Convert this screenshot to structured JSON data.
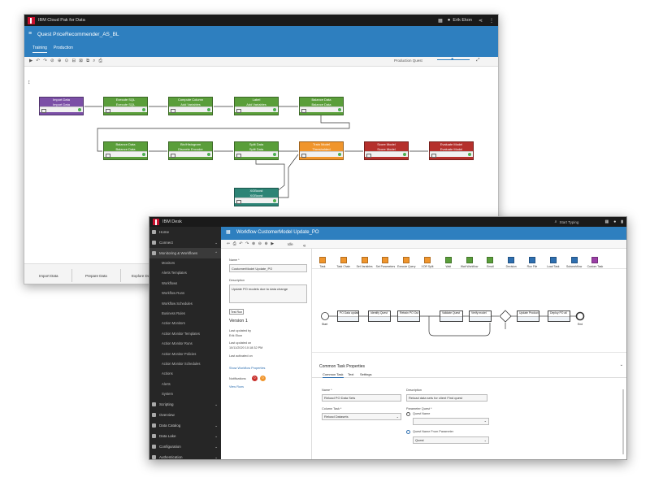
{
  "win1": {
    "app_title": "IBM Cloud Pak for Data",
    "user": "Erik Ekon",
    "project_title": "Quest PriceRecommender_AS_BL",
    "tabs": [
      "Training",
      "Production"
    ],
    "prod_label": "Production Quest",
    "nodes": [
      {
        "title": "Import Data",
        "sub": "Import Data",
        "color": "purple"
      },
      {
        "title": "Execute SQL",
        "sub": "Execute SQL",
        "color": "green"
      },
      {
        "title": "Compute Column",
        "sub": "Add Variables",
        "color": "green"
      },
      {
        "title": "Label",
        "sub": "Add Variables",
        "color": "green"
      },
      {
        "title": "Balance Data",
        "sub": "Balance Data",
        "color": "green"
      },
      {
        "title": "Balance Data",
        "sub": "Balance Data",
        "color": "green"
      },
      {
        "title": "Bin/Histogram",
        "sub": "Discrete Encoder",
        "color": "green"
      },
      {
        "title": "Split Data",
        "sub": "Split Data",
        "color": "green"
      },
      {
        "title": "Train Model",
        "sub": "Thresholded",
        "color": "orange"
      },
      {
        "title": "Score Model",
        "sub": "Score Model",
        "color": "red"
      },
      {
        "title": "Evaluate Model",
        "sub": "Evaluate Model",
        "color": "red"
      },
      {
        "title": "XGBoost",
        "sub": "XGBoost",
        "color": "teal"
      }
    ],
    "bottom_tabs": [
      "Import Data",
      "Prepare Data",
      "Explore Data"
    ]
  },
  "win2": {
    "app_title": "IBM Desk",
    "search_placeholder": "Start Typing",
    "header_title": "Workflow CustomerModel Update_PO",
    "toolbar_label": "Idle",
    "sidebar": {
      "top": [
        {
          "label": "Home"
        },
        {
          "label": "Connect"
        },
        {
          "label": "Monitoring & Workflows"
        }
      ],
      "sub": [
        "Monitors",
        "Alerts Templates",
        "Workflows",
        "Workflow Runs",
        "Workflow Schedules",
        "Business Rules",
        "Action Monitors",
        "Action Monitor Templates",
        "Action Monitor Runs",
        "Action Monitor Policies",
        "Action Monitor Schedules",
        "Actions",
        "Alerts",
        "System"
      ],
      "bottom": [
        {
          "label": "Scripting"
        },
        {
          "label": "Overview"
        },
        {
          "label": "Data Catalog"
        },
        {
          "label": "Data Lake"
        },
        {
          "label": "Configuration"
        },
        {
          "label": "Authentication"
        }
      ]
    },
    "props": {
      "name_label": "Name *",
      "name_value": "CustomerModel Update_PO",
      "desc_label": "Description",
      "desc_value": "Update PO models due to data change",
      "test_button": "Test Run",
      "version": "Version 1",
      "updated_by_label": "Last updated by",
      "updated_by": "Erik Ekon",
      "updated_on_label": "Last updated on",
      "updated_on": "10/11/2020 10:18:32 PM",
      "enabled_label": "Last activated on",
      "show_link": "Show Workflow Properties",
      "notifications": "Notifications",
      "notif_count_red": "0",
      "notif_count_orange": "0",
      "view_link": "View Runs"
    },
    "palette": [
      {
        "label": "Task",
        "color": "#f0952c"
      },
      {
        "label": "Task Chain",
        "color": "#f0952c"
      },
      {
        "label": "Set Variables",
        "color": "#f0952c"
      },
      {
        "label": "Set Parameters",
        "color": "#f0952c"
      },
      {
        "label": "Execute Query",
        "color": "#f0952c"
      },
      {
        "label": "XOR Split",
        "color": "#f0952c"
      },
      {
        "label": "Wait",
        "color": "#5a9e3a"
      },
      {
        "label": "Wait Workflow",
        "color": "#5a9e3a"
      },
      {
        "label": "Email",
        "color": "#5a9e3a"
      },
      {
        "label": "Decision",
        "color": "#2e6fb0"
      },
      {
        "label": "Run File",
        "color": "#2e6fb0"
      },
      {
        "label": "Load Task",
        "color": "#2e6fb0"
      },
      {
        "label": "Subworkflow",
        "color": "#2e6fb0"
      },
      {
        "label": "Custom Task",
        "color": "#9b3fa6"
      }
    ],
    "flow_nodes": [
      "PO Data update",
      "Identify Quest",
      "Retrain PO Out",
      "Validate Quest",
      "Verify model",
      "Update Product",
      "Deploy PO all"
    ],
    "start_label": "Start",
    "end_label": "End",
    "bottom_panel": {
      "title": "Common Task Properties",
      "tabs": [
        "Common Task",
        "Text",
        "Settings"
      ],
      "name_label": "Name *",
      "name_value": "Reload PO Data Sets",
      "desc_label": "Description",
      "desc_value": "Reload data sets for client Find quest",
      "coltask_label": "Column Task *",
      "coltask_value": "Reload Datasets",
      "param_label": "Parameter Quest *",
      "radio1": "Quest Name",
      "radio2": "Quest Name From Parameter",
      "select_value": "Quest"
    }
  }
}
